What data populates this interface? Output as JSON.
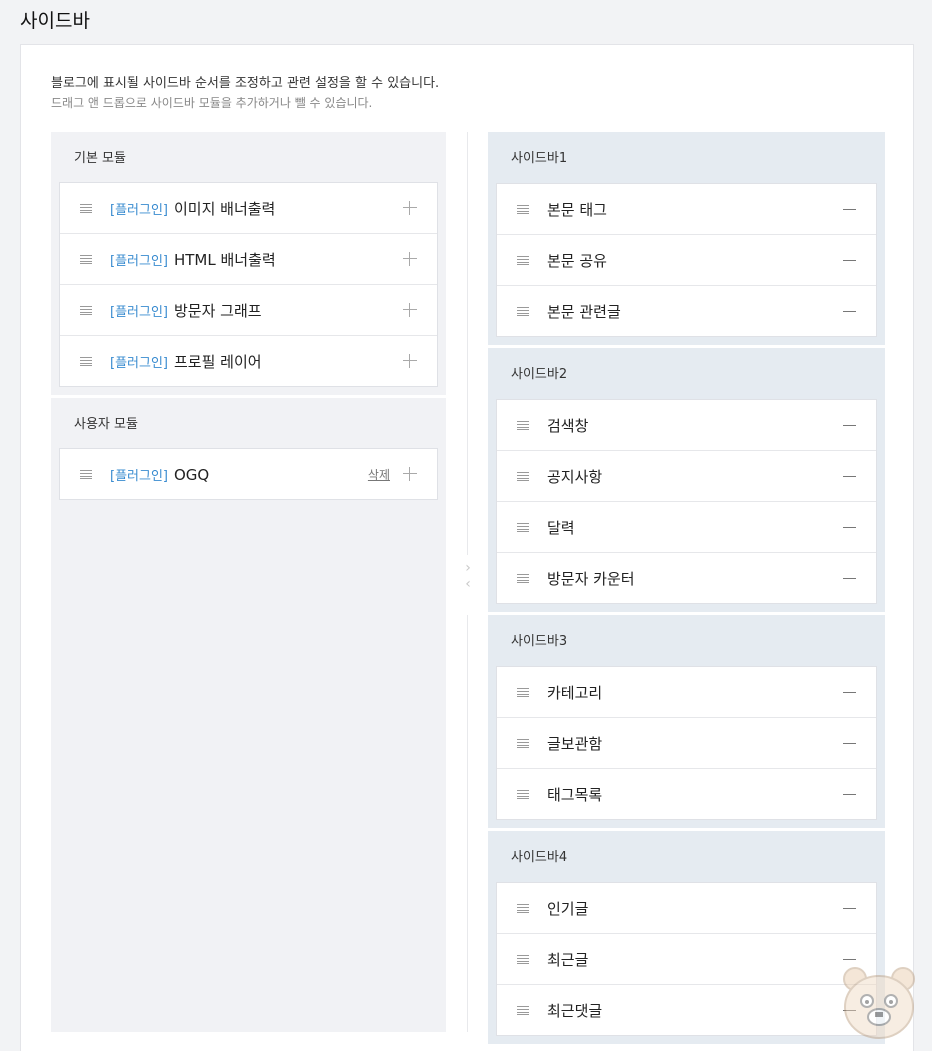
{
  "page": {
    "title": "사이드바",
    "description": "블로그에 표시될 사이드바 순서를 조정하고 관련 설정을 할 수 있습니다.",
    "hint": "드래그 앤 드롭으로 사이드바 모듈을 추가하거나 뺄 수 있습니다."
  },
  "basic_modules": {
    "title": "기본 모듈",
    "items": [
      {
        "tag": "[플러그인]",
        "label": "이미지 배너출력"
      },
      {
        "tag": "[플러그인]",
        "label": "HTML 배너출력"
      },
      {
        "tag": "[플러그인]",
        "label": "방문자 그래프"
      },
      {
        "tag": "[플러그인]",
        "label": "프로필 레이어"
      }
    ]
  },
  "user_modules": {
    "title": "사용자 모듈",
    "items": [
      {
        "tag": "[플러그인]",
        "label": "OGQ",
        "delete_label": "삭제"
      }
    ]
  },
  "sidebars": [
    {
      "title": "사이드바1",
      "items": [
        "본문 태그",
        "본문 공유",
        "본문 관련글"
      ]
    },
    {
      "title": "사이드바2",
      "items": [
        "검색창",
        "공지사항",
        "달력",
        "방문자 카운터"
      ]
    },
    {
      "title": "사이드바3",
      "items": [
        "카테고리",
        "글보관함",
        "태그목록"
      ]
    },
    {
      "title": "사이드바4",
      "items": [
        "인기글",
        "최근글",
        "최근댓글"
      ]
    }
  ],
  "icons": {
    "drag_handle": "drag-handle-icon",
    "add": "plus-icon",
    "remove": "minus-icon",
    "move": "chevron-left-right-icon"
  },
  "colors": {
    "plugin_tag": "#3a8cd0",
    "left_column_bg": "#f1f2f5",
    "sidebar_section_bg": "#e5ebf1"
  }
}
